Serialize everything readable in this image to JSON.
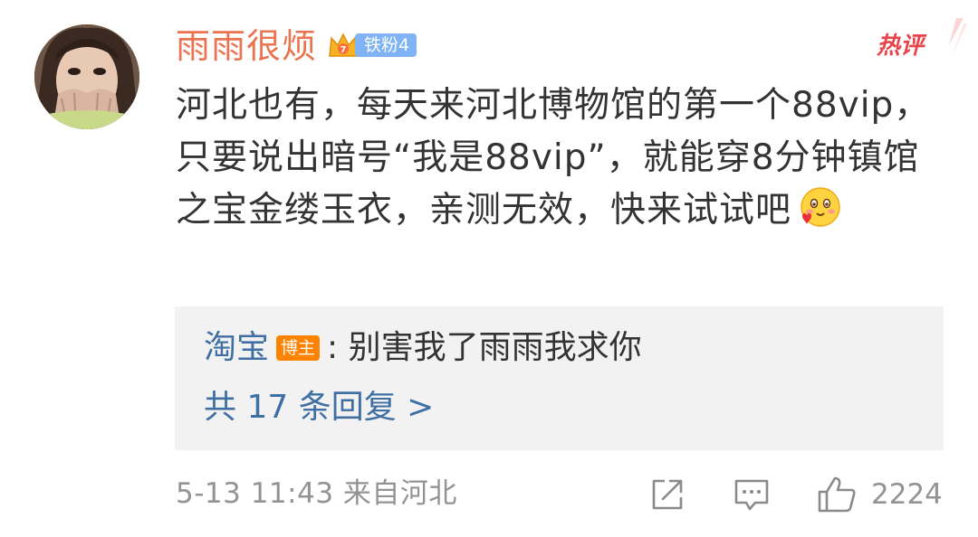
{
  "comment": {
    "username": "雨雨很烦",
    "fan_badge": "铁粉4",
    "hot_tag": "热评",
    "text": "河北也有，每天来河北博物馆的第一个88vip，只要说出暗号“我是88vip”，就能穿8分钟镇馆之宝金缕玉衣，亲测无效，快来试试吧",
    "emoji": "smiling-hearts-emoji",
    "time": "5-13 11:43",
    "location": "来自河北",
    "like_count": "2224"
  },
  "reply": {
    "author": "淘宝",
    "badge": "博主",
    "text": ": 别害我了雨雨我求你",
    "more": "共 17 条回复 >"
  },
  "icons": [
    "avatar",
    "crown-icon",
    "share-icon",
    "comment-icon",
    "like-icon"
  ],
  "colors": {
    "username": "#eb7350",
    "link_blue": "#3f6fa3",
    "hot_red": "#e8454a",
    "fan_badge_bg": "#7fb3f5",
    "blogger_badge_bg": "#ff8200",
    "reply_bg": "#f2f2f2",
    "meta_gray": "#939393"
  }
}
